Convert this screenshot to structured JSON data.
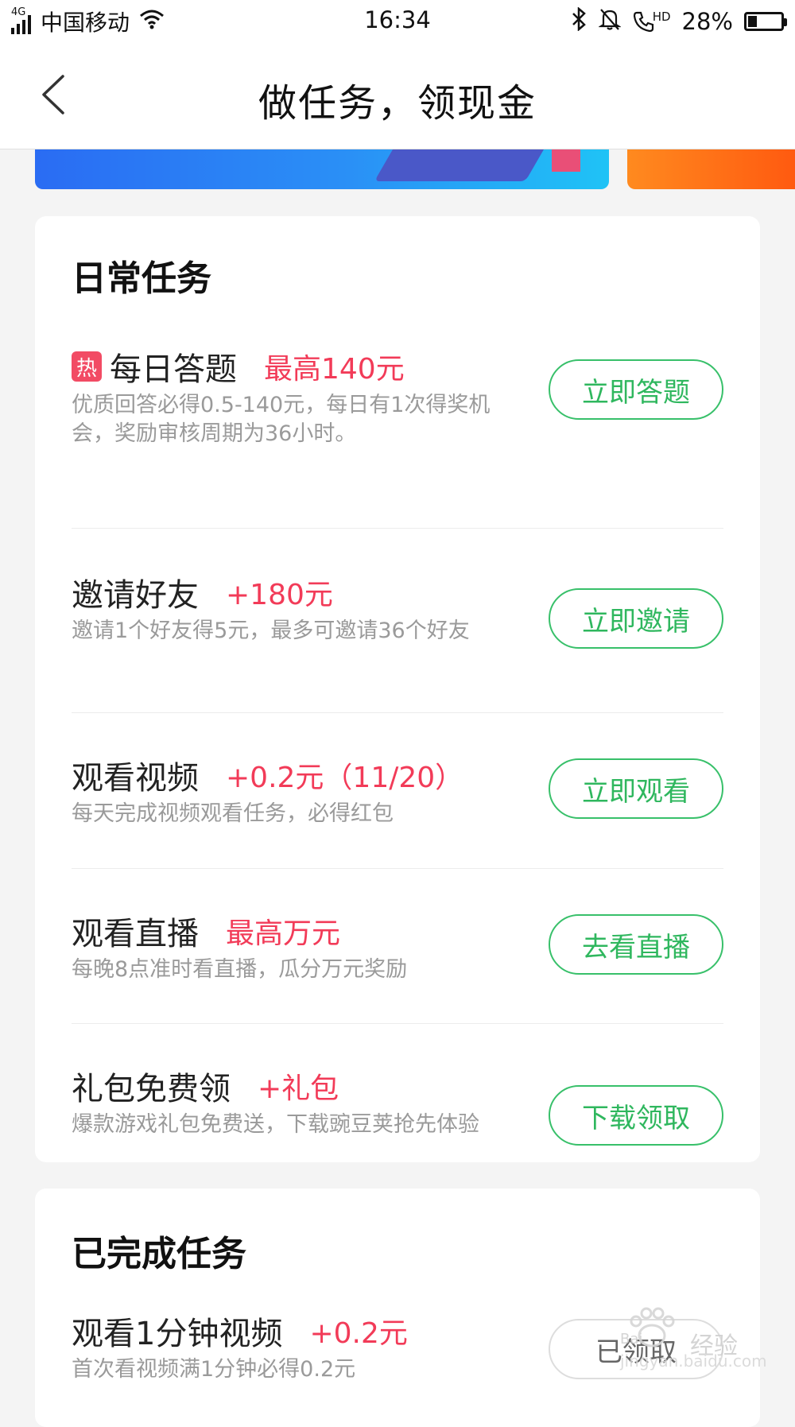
{
  "status_bar": {
    "network": "4G",
    "carrier": "中国移动",
    "time": "16:34",
    "hd_label": "HD",
    "battery_text": "28%",
    "battery_level": 0.28
  },
  "header": {
    "title": "做任务，领现金",
    "back_icon": "chevron-left-icon"
  },
  "daily": {
    "title": "日常任务",
    "tasks": [
      {
        "badge": "热",
        "name": "每日答题",
        "reward": "最高140元",
        "desc": "优质回答必得0.5-140元，每日有1次得奖机会，奖励审核周期为36小时。",
        "button": "立即答题"
      },
      {
        "name": "邀请好友",
        "reward": "+180元",
        "desc": "邀请1个好友得5元，最多可邀请36个好友",
        "button": "立即邀请"
      },
      {
        "name": "观看视频",
        "reward": "+0.2元（11/20）",
        "desc": "每天完成视频观看任务，必得红包",
        "button": "立即观看"
      },
      {
        "name": "观看直播",
        "reward": "最高万元",
        "desc": "每晚8点准时看直播，瓜分万元奖励",
        "button": "去看直播"
      },
      {
        "name": "礼包免费领",
        "reward": "+礼包",
        "desc": "爆款游戏礼包免费送，下载豌豆荚抢先体验",
        "button": "下载领取"
      }
    ]
  },
  "completed": {
    "title": "已完成任务",
    "tasks": [
      {
        "name": "观看1分钟视频",
        "reward": "+0.2元",
        "desc": "首次看视频满1分钟必得0.2元",
        "button": "已领取"
      }
    ]
  },
  "watermark": {
    "brand": "Bai",
    "label": "经验",
    "url": "jingyan.baidu.com"
  },
  "colors": {
    "accent_green": "#2fb75e",
    "reward_red": "#f23b58",
    "hot_badge": "#f24b64"
  }
}
